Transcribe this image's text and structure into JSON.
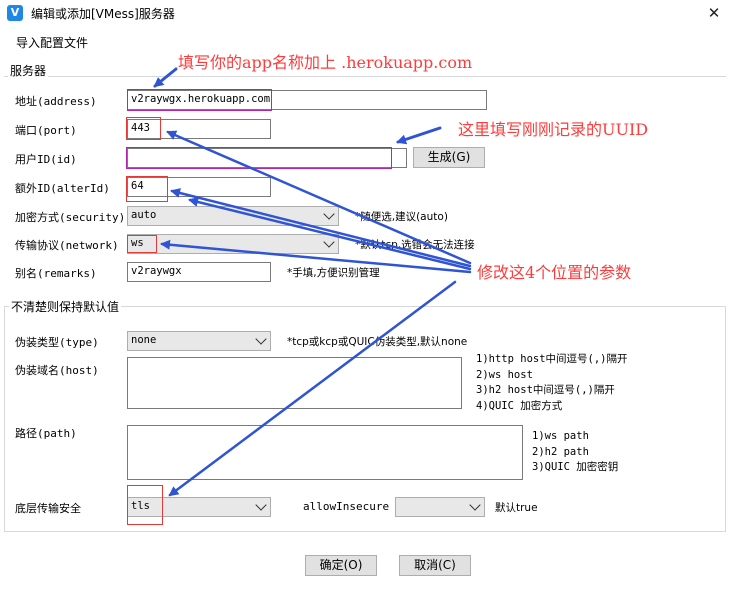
{
  "window": {
    "title": "编辑或添加[VMess]服务器",
    "close": "✕",
    "app_icon": "V"
  },
  "menu": {
    "import_config": "导入配置文件"
  },
  "server_group": {
    "title": "服务器",
    "address": {
      "label": "地址(address)",
      "value": "v2raywgx.herokuapp.com"
    },
    "port": {
      "label": "端口(port)",
      "value": "443"
    },
    "user_id": {
      "label": "用户ID(id)",
      "value": "",
      "generate_button": "生成(G)"
    },
    "alter_id": {
      "label": "额外ID(alterId)",
      "value": "64"
    },
    "security": {
      "label": "加密方式(security)",
      "value": "auto",
      "hint": "*随便选,建议(auto)"
    },
    "network": {
      "label": "传输协议(network)",
      "value": "ws",
      "hint": "*默认tcp,选错会无法连接"
    },
    "remarks": {
      "label": "别名(remarks)",
      "value": "v2raywgx",
      "hint": "*手填,方便识别管理"
    }
  },
  "advanced_group": {
    "title": "不清楚则保持默认值",
    "type": {
      "label": "伪装类型(type)",
      "value": "none",
      "hint": "*tcp或kcp或QUIC伪装类型,默认none"
    },
    "host": {
      "label": "伪装域名(host)",
      "value": "",
      "notes": [
        "1)http host中间逗号(,)隔开",
        "2)ws host",
        "3)h2 host中间逗号(,)隔开",
        "4)QUIC 加密方式"
      ]
    },
    "path": {
      "label": "路径(path)",
      "value": "",
      "notes": [
        "1)ws path",
        "2)h2 path",
        "3)QUIC 加密密钥"
      ]
    },
    "tls": {
      "label": "底层传输安全",
      "value": "tls"
    },
    "allow_insecure": {
      "label": "allowInsecure",
      "value": "",
      "hint": "默认true"
    }
  },
  "footer": {
    "ok": "确定(O)",
    "cancel": "取消(C)"
  },
  "annotations": {
    "app_name": "填写你的app名称加上 .herokuapp.com",
    "uuid": "这里填写刚刚记录的UUID",
    "params": "修改这4个位置的参数"
  },
  "colors": {
    "annotation_text": "#ff3b3b",
    "arrow": "#2f54d4",
    "highlight_red": "#e53935",
    "highlight_purple": "#b026b0"
  }
}
